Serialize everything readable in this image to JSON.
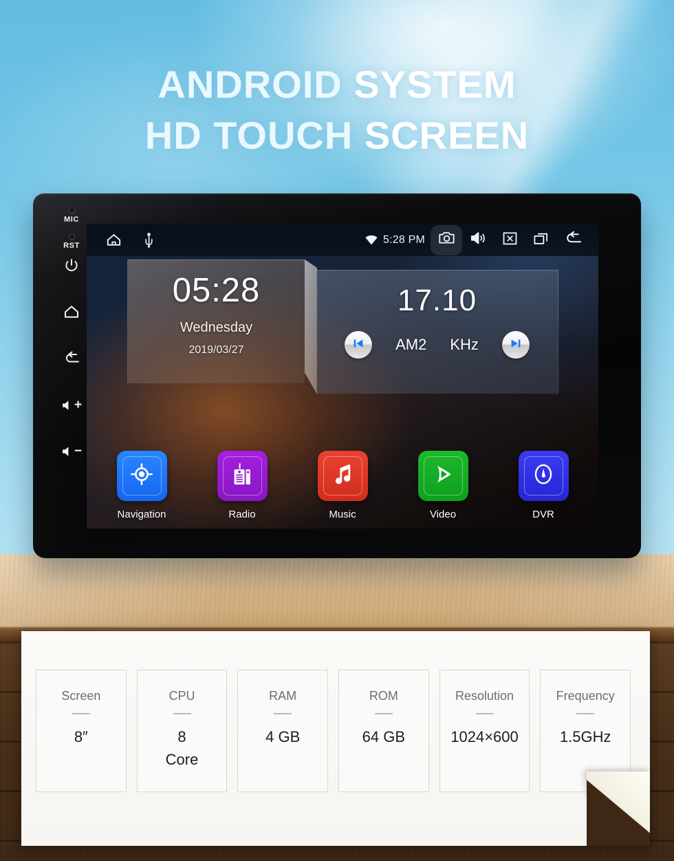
{
  "headline": {
    "line1_a": "ANDROID ",
    "line1_b": "SYSTEM",
    "line2_a": "HD TOUCH ",
    "line2_b": "SCREEN"
  },
  "device": {
    "bezel": {
      "mic_label": "MIC",
      "rst_label": "RST",
      "power_icon": "power-icon",
      "home_icon": "home-icon",
      "back_icon": "back-icon",
      "volume_up_label": "+",
      "volume_down_label": "−"
    },
    "statusbar": {
      "home_icon": "home-icon",
      "usb_icon": "usb-icon",
      "wifi_icon": "wifi-icon",
      "time": "5:28 PM",
      "camera_icon": "camera-icon",
      "volume_icon": "volume-icon",
      "close_icon": "close-box-icon",
      "recents_icon": "recent-apps-icon",
      "back_icon": "back-arrow-icon"
    },
    "clock_widget": {
      "time": "05:28",
      "weekday": "Wednesday",
      "date": "2019/03/27"
    },
    "radio_widget": {
      "frequency": "17.10",
      "band": "AM2",
      "unit": "KHz",
      "prev_icon": "skip-previous-icon",
      "next_icon": "skip-next-icon"
    },
    "apps": [
      {
        "label": "Navigation",
        "icon": "navigation-target-icon",
        "color": "#1467f0",
        "color2": "#1f7bfb"
      },
      {
        "label": "Radio",
        "icon": "radio-receiver-icon",
        "color": "#8a15c4",
        "color2": "#a320e0"
      },
      {
        "label": "Music",
        "icon": "music-note-icon",
        "color": "#d83222",
        "color2": "#ea4231"
      },
      {
        "label": "Video",
        "icon": "video-play-icon",
        "color": "#0f9f20",
        "color2": "#1cb92c"
      },
      {
        "label": "DVR",
        "icon": "dvr-gauge-icon",
        "color": "#2b2bdf",
        "color2": "#3b3bf2"
      }
    ]
  },
  "specs": [
    {
      "label": "Screen",
      "value": "8″"
    },
    {
      "label": "CPU",
      "value": "8\nCore"
    },
    {
      "label": "RAM",
      "value": "4 GB"
    },
    {
      "label": "ROM",
      "value": "64 GB"
    },
    {
      "label": "Resolution",
      "value": "1024×600"
    },
    {
      "label": "Frequency",
      "value": "1.5GHz"
    }
  ]
}
